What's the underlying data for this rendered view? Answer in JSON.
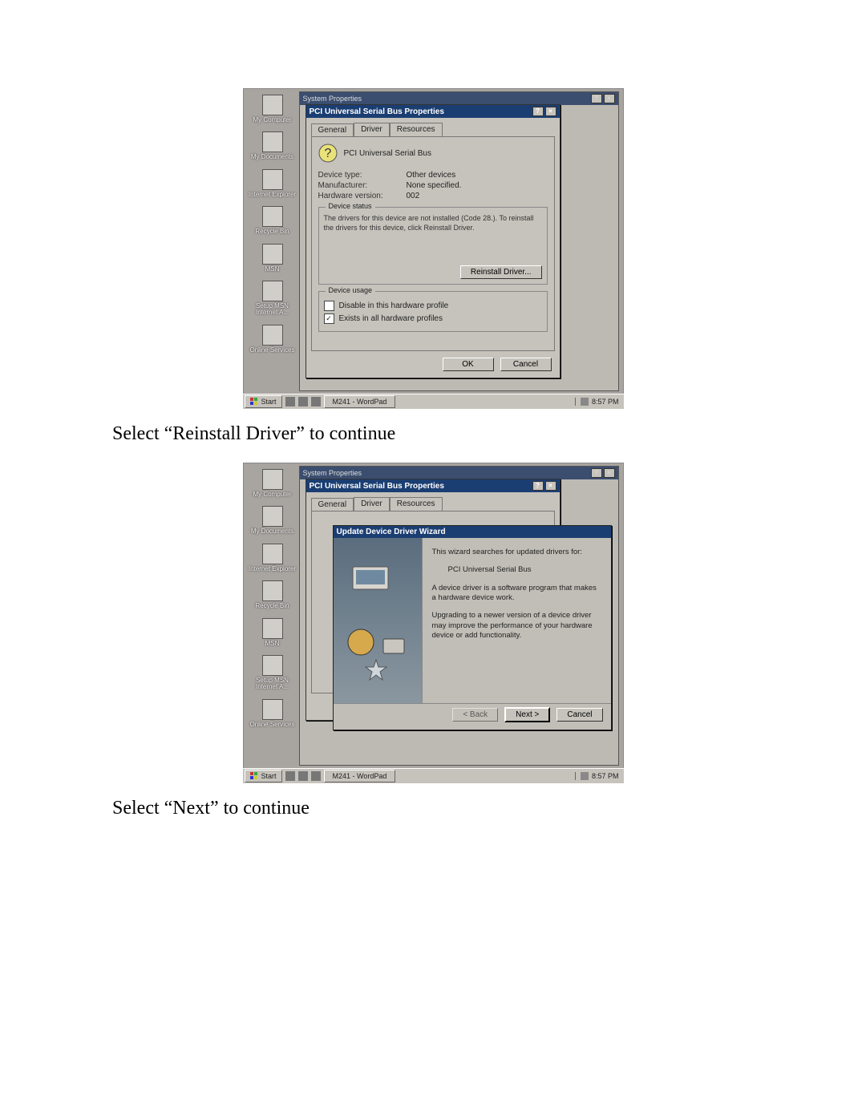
{
  "captions": {
    "after_screenshot1": "Select “Reinstall Driver” to continue",
    "after_screenshot2": "Select “Next” to continue"
  },
  "desktop_icons": [
    {
      "label": "My Computer"
    },
    {
      "label": "My Documents"
    },
    {
      "label": "Internet Explorer"
    },
    {
      "label": "Recycle Bin"
    },
    {
      "label": "MSN"
    },
    {
      "label": "Setup MSN Internet A..."
    },
    {
      "label": "Online Services"
    }
  ],
  "taskbar": {
    "start": "Start",
    "task_app": "M241 - WordPad",
    "clock1": "8:57 PM",
    "clock2": "8:57 PM"
  },
  "sysprops_title": "System Properties",
  "prop_dialog": {
    "title": "PCI Universal Serial Bus Properties",
    "tabs": {
      "general": "General",
      "driver": "Driver",
      "resources": "Resources"
    },
    "device_name": "PCI Universal Serial Bus",
    "kv": {
      "device_type_k": "Device type:",
      "device_type_v": "Other devices",
      "manufacturer_k": "Manufacturer:",
      "manufacturer_v": "None specified.",
      "hw_version_k": "Hardware version:",
      "hw_version_v": "002"
    },
    "status_legend": "Device status",
    "status_text": "The drivers for this device are not installed (Code 28.). To reinstall the drivers for this device, click Reinstall Driver.",
    "reinstall_btn": "Reinstall Driver...",
    "usage_legend": "Device usage",
    "usage_disable": "Disable in this hardware profile",
    "usage_exists": "Exists in all hardware profiles",
    "ok": "OK",
    "cancel": "Cancel"
  },
  "wizard": {
    "title": "Update Device Driver Wizard",
    "line1": "This wizard searches for updated drivers for:",
    "device": "PCI Universal Serial Bus",
    "line2": "A device driver is a software program that makes a hardware device work.",
    "line3": "Upgrading to a newer version of a device driver may improve the performance of your hardware device or add functionality.",
    "back": "< Back",
    "next": "Next >",
    "cancel": "Cancel"
  }
}
